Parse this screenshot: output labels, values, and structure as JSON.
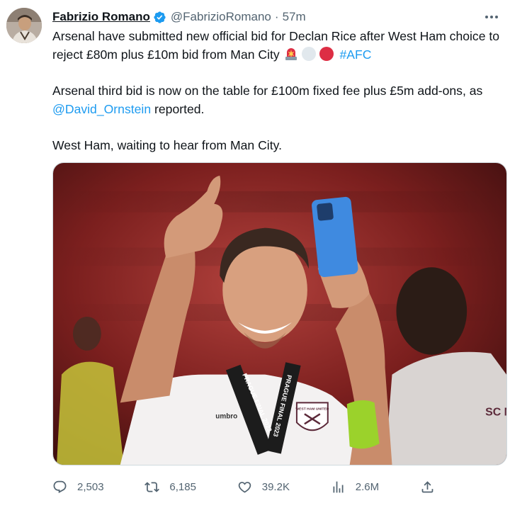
{
  "tweet": {
    "author_name": "Fabrizio Romano",
    "handle": "@FabrizioRomano",
    "separator": "·",
    "time": "57m",
    "text": {
      "p1_text": "Arsenal have submitted new official bid for Declan Rice after West Ham choice to reject £80m plus £10m bid from Man City",
      "p1_hashtag": "#AFC",
      "p2_before": "Arsenal third bid is now on the table for £100m fixed fee plus £5m add-ons, as ",
      "p2_mention": "@David_Ornstein",
      "p2_after": " reported.",
      "p3": "West Ham, waiting to hear from Man City."
    },
    "emojis": [
      "siren-icon",
      "white-circle-icon",
      "red-circle-icon"
    ],
    "photo": {
      "medal_text": "PRAGUE FINAL 2023",
      "crest_text": "WEST HAM UNITED",
      "sponsor_text": "umbro",
      "bg_text": "SC MAR"
    },
    "stats": {
      "replies": "2,503",
      "retweets": "6,185",
      "likes": "39.2K",
      "views": "2.6M"
    },
    "colors": {
      "link": "#1d9bf0",
      "muted": "#536471",
      "verified": "#1d9bf0"
    }
  }
}
